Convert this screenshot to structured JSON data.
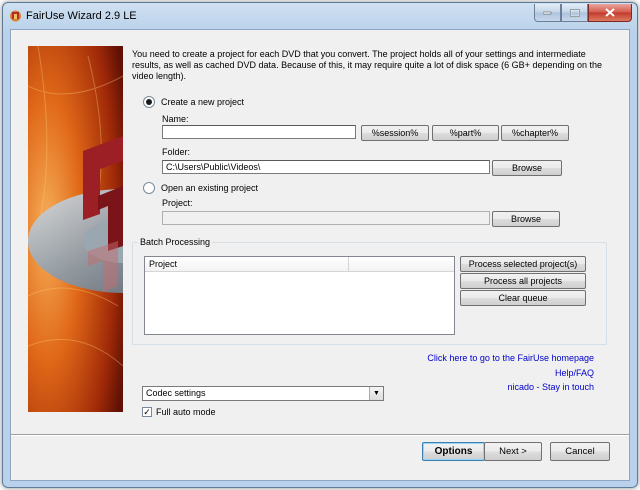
{
  "window": {
    "title": "FairUse Wizard 2.9 LE",
    "buttons": [
      "minimize",
      "maximize",
      "close"
    ]
  },
  "description": "You need to create a project for each DVD that you convert. The project holds all of your settings and intermediate results, as well as cached DVD data. Because of this, it may require quite a lot of disk space (6 GB+ depending on the video length).",
  "new_project": {
    "radio_label": "Create a new project",
    "selected": true,
    "name_label": "Name:",
    "name_value": "",
    "session_btn": "%session%",
    "part_btn": "%part%",
    "chapter_btn": "%chapter%",
    "folder_label": "Folder:",
    "folder_value": "C:\\Users\\Public\\Videos\\",
    "browse_btn": "Browse"
  },
  "existing_project": {
    "radio_label": "Open an existing project",
    "selected": false,
    "project_label": "Project:",
    "project_value": "",
    "browse_btn": "Browse"
  },
  "batch": {
    "group_label": "Batch Processing",
    "columns": [
      "Project",
      ""
    ],
    "rows": [],
    "process_selected_btn": "Process selected project(s)",
    "process_all_btn": "Process all projects",
    "clear_queue_btn": "Clear queue"
  },
  "links": {
    "homepage": "Click here to go to the FairUse homepage",
    "help": "Help/FAQ",
    "stay_in_touch": "nicado - Stay in touch"
  },
  "codec": {
    "selected": "Codec settings"
  },
  "full_auto": {
    "label": "Full auto mode",
    "checked": true,
    "check_glyph": "✓"
  },
  "footer": {
    "options_btn": "Options",
    "next_btn": "Next >",
    "cancel_btn": "Cancel"
  },
  "colors": {
    "link": "#0000cc",
    "dialog_bg": "#f0f0f0",
    "titlebar": "#b9d1ea",
    "close_button": "#c8483a"
  }
}
